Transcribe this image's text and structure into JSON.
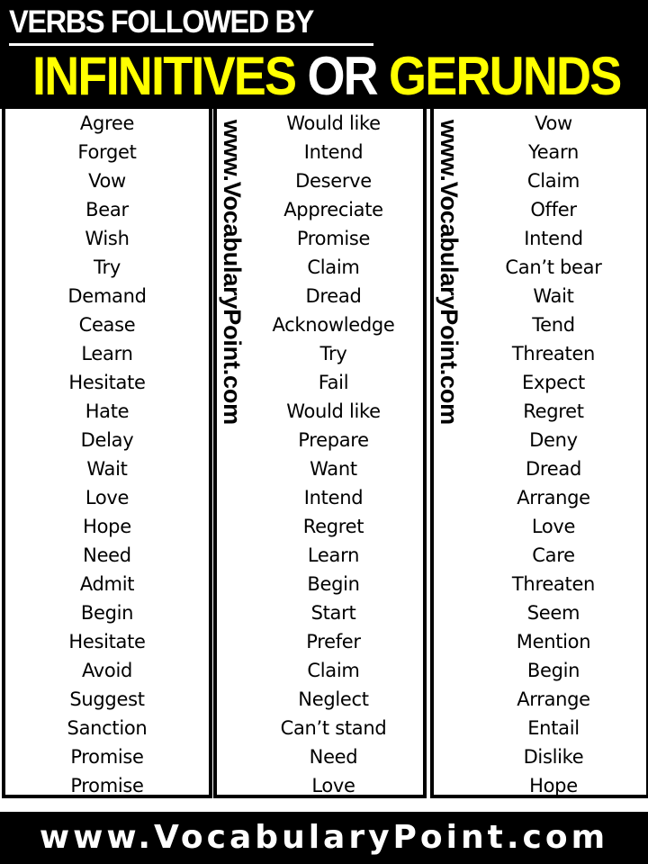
{
  "header": {
    "title_line1": "VERBS FOLLOWED BY",
    "title_word1": "INFINITIVES",
    "title_word2": "OR",
    "title_word3": "GERUNDS",
    "colors": {
      "background": "#000000",
      "primary_text": "#ffffff",
      "accent": "#ffff00"
    }
  },
  "watermark": "www.VocabularyPoint.com",
  "columns": [
    {
      "words": [
        "Agree",
        "Forget",
        "Vow",
        "Bear",
        "Wish",
        "Try",
        "Demand",
        "Cease",
        "Learn",
        "Hesitate",
        "Hate",
        "Delay",
        "Wait",
        "Love",
        "Hope",
        "Need",
        "Admit",
        "Begin",
        "Hesitate",
        "Avoid",
        "Suggest",
        "Sanction",
        "Promise",
        "Promise"
      ]
    },
    {
      "words": [
        "Would like",
        "Intend",
        "Deserve",
        "Appreciate",
        "Promise",
        "Claim",
        "Dread",
        "Acknowledge",
        "Try",
        "Fail",
        "Would like",
        "Prepare",
        "Want",
        "Intend",
        "Regret",
        "Learn",
        "Begin",
        "Start",
        "Prefer",
        "Claim",
        "Neglect",
        "Can’t stand",
        "Need",
        "Love"
      ]
    },
    {
      "words": [
        "Vow",
        "Yearn",
        "Claim",
        "Offer",
        "Intend",
        "Can’t bear",
        "Wait",
        "Tend",
        "Threaten",
        "Expect",
        "Regret",
        "Deny",
        "Dread",
        "Arrange",
        "Love",
        "Care",
        "Threaten",
        "Seem",
        "Mention",
        "Begin",
        "Arrange",
        "Entail",
        "Dislike",
        "Hope"
      ]
    }
  ],
  "footer": {
    "url": "www.VocabularyPoint.com"
  }
}
